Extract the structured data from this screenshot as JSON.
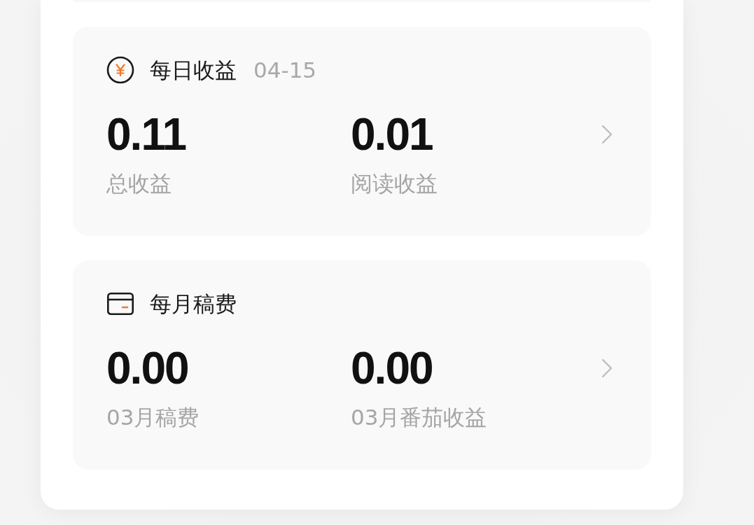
{
  "cards": [
    {
      "kind": "daily",
      "title": "每日收益",
      "date": "04-15",
      "metrics": [
        {
          "value": "0.11",
          "label": "总收益"
        },
        {
          "value": "0.01",
          "label": "阅读收益"
        }
      ]
    },
    {
      "kind": "monthly",
      "title": "每月稿费",
      "metrics": [
        {
          "value": "0.00",
          "label": "03月稿费"
        },
        {
          "value": "0.00",
          "label": "03月番茄收益"
        }
      ]
    }
  ]
}
